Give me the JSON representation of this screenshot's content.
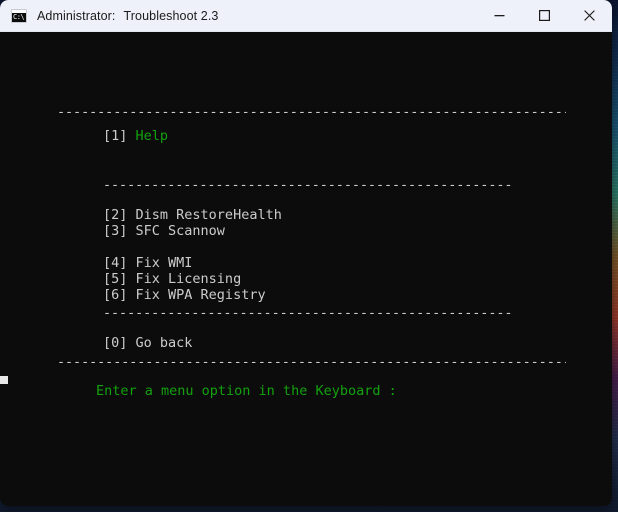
{
  "window": {
    "title_prefix": "Administrator:",
    "title_app": "Troubleshoot 2.3",
    "icon": "cmd-console-icon",
    "icon_glyph": "C:\\",
    "controls": {
      "minimize_label": "Minimize",
      "maximize_label": "Maximize",
      "close_label": "Close"
    },
    "colors": {
      "titlebar_bg": "#eef1f9",
      "titlebar_text": "#1b1b1b",
      "console_bg": "#0c0c0c",
      "console_fg": "#cccccc",
      "accent_green": "#13a10e"
    }
  },
  "console": {
    "separators": {
      "full": "--------------------------------------------------------------------------------------------------------------------------",
      "indented": "------------------------------------------------------------------------------------------------"
    },
    "menu": [
      {
        "key": "[1]",
        "label": "Help",
        "color": "green"
      },
      {
        "key": "[2]",
        "label": "Dism RestoreHealth",
        "color": "grey"
      },
      {
        "key": "[3]",
        "label": "SFC Scannow",
        "color": "grey"
      },
      {
        "key": "[4]",
        "label": "Fix WMI",
        "color": "grey"
      },
      {
        "key": "[5]",
        "label": "Fix Licensing",
        "color": "grey"
      },
      {
        "key": "[6]",
        "label": "Fix WPA Registry",
        "color": "grey"
      },
      {
        "key": "[0]",
        "label": "Go back",
        "color": "grey"
      }
    ],
    "items": {
      "item1_key": "[1]",
      "item1_label": "Help",
      "item2_key": "[2]",
      "item2_label": "Dism RestoreHealth",
      "item3_key": "[3]",
      "item3_label": "SFC Scannow",
      "item4_key": "[4]",
      "item4_label": "Fix WMI",
      "item5_key": "[5]",
      "item5_label": "Fix Licensing",
      "item6_key": "[6]",
      "item6_label": "Fix WPA Registry",
      "item0_key": "[0]",
      "item0_label": "Go back"
    },
    "prompt": "Enter a menu option in the Keyboard :"
  }
}
